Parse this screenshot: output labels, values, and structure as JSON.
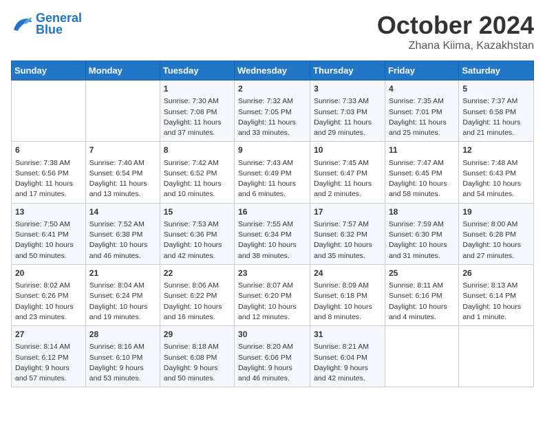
{
  "header": {
    "logo_line1": "General",
    "logo_line2": "Blue",
    "month": "October 2024",
    "location": "Zhana Kiima, Kazakhstan"
  },
  "days_of_week": [
    "Sunday",
    "Monday",
    "Tuesday",
    "Wednesday",
    "Thursday",
    "Friday",
    "Saturday"
  ],
  "weeks": [
    [
      {
        "day": "",
        "sunrise": "",
        "sunset": "",
        "daylight": ""
      },
      {
        "day": "",
        "sunrise": "",
        "sunset": "",
        "daylight": ""
      },
      {
        "day": "1",
        "sunrise": "Sunrise: 7:30 AM",
        "sunset": "Sunset: 7:08 PM",
        "daylight": "Daylight: 11 hours and 37 minutes."
      },
      {
        "day": "2",
        "sunrise": "Sunrise: 7:32 AM",
        "sunset": "Sunset: 7:05 PM",
        "daylight": "Daylight: 11 hours and 33 minutes."
      },
      {
        "day": "3",
        "sunrise": "Sunrise: 7:33 AM",
        "sunset": "Sunset: 7:03 PM",
        "daylight": "Daylight: 11 hours and 29 minutes."
      },
      {
        "day": "4",
        "sunrise": "Sunrise: 7:35 AM",
        "sunset": "Sunset: 7:01 PM",
        "daylight": "Daylight: 11 hours and 25 minutes."
      },
      {
        "day": "5",
        "sunrise": "Sunrise: 7:37 AM",
        "sunset": "Sunset: 6:58 PM",
        "daylight": "Daylight: 11 hours and 21 minutes."
      }
    ],
    [
      {
        "day": "6",
        "sunrise": "Sunrise: 7:38 AM",
        "sunset": "Sunset: 6:56 PM",
        "daylight": "Daylight: 11 hours and 17 minutes."
      },
      {
        "day": "7",
        "sunrise": "Sunrise: 7:40 AM",
        "sunset": "Sunset: 6:54 PM",
        "daylight": "Daylight: 11 hours and 13 minutes."
      },
      {
        "day": "8",
        "sunrise": "Sunrise: 7:42 AM",
        "sunset": "Sunset: 6:52 PM",
        "daylight": "Daylight: 11 hours and 10 minutes."
      },
      {
        "day": "9",
        "sunrise": "Sunrise: 7:43 AM",
        "sunset": "Sunset: 6:49 PM",
        "daylight": "Daylight: 11 hours and 6 minutes."
      },
      {
        "day": "10",
        "sunrise": "Sunrise: 7:45 AM",
        "sunset": "Sunset: 6:47 PM",
        "daylight": "Daylight: 11 hours and 2 minutes."
      },
      {
        "day": "11",
        "sunrise": "Sunrise: 7:47 AM",
        "sunset": "Sunset: 6:45 PM",
        "daylight": "Daylight: 10 hours and 58 minutes."
      },
      {
        "day": "12",
        "sunrise": "Sunrise: 7:48 AM",
        "sunset": "Sunset: 6:43 PM",
        "daylight": "Daylight: 10 hours and 54 minutes."
      }
    ],
    [
      {
        "day": "13",
        "sunrise": "Sunrise: 7:50 AM",
        "sunset": "Sunset: 6:41 PM",
        "daylight": "Daylight: 10 hours and 50 minutes."
      },
      {
        "day": "14",
        "sunrise": "Sunrise: 7:52 AM",
        "sunset": "Sunset: 6:38 PM",
        "daylight": "Daylight: 10 hours and 46 minutes."
      },
      {
        "day": "15",
        "sunrise": "Sunrise: 7:53 AM",
        "sunset": "Sunset: 6:36 PM",
        "daylight": "Daylight: 10 hours and 42 minutes."
      },
      {
        "day": "16",
        "sunrise": "Sunrise: 7:55 AM",
        "sunset": "Sunset: 6:34 PM",
        "daylight": "Daylight: 10 hours and 38 minutes."
      },
      {
        "day": "17",
        "sunrise": "Sunrise: 7:57 AM",
        "sunset": "Sunset: 6:32 PM",
        "daylight": "Daylight: 10 hours and 35 minutes."
      },
      {
        "day": "18",
        "sunrise": "Sunrise: 7:59 AM",
        "sunset": "Sunset: 6:30 PM",
        "daylight": "Daylight: 10 hours and 31 minutes."
      },
      {
        "day": "19",
        "sunrise": "Sunrise: 8:00 AM",
        "sunset": "Sunset: 6:28 PM",
        "daylight": "Daylight: 10 hours and 27 minutes."
      }
    ],
    [
      {
        "day": "20",
        "sunrise": "Sunrise: 8:02 AM",
        "sunset": "Sunset: 6:26 PM",
        "daylight": "Daylight: 10 hours and 23 minutes."
      },
      {
        "day": "21",
        "sunrise": "Sunrise: 8:04 AM",
        "sunset": "Sunset: 6:24 PM",
        "daylight": "Daylight: 10 hours and 19 minutes."
      },
      {
        "day": "22",
        "sunrise": "Sunrise: 8:06 AM",
        "sunset": "Sunset: 6:22 PM",
        "daylight": "Daylight: 10 hours and 16 minutes."
      },
      {
        "day": "23",
        "sunrise": "Sunrise: 8:07 AM",
        "sunset": "Sunset: 6:20 PM",
        "daylight": "Daylight: 10 hours and 12 minutes."
      },
      {
        "day": "24",
        "sunrise": "Sunrise: 8:09 AM",
        "sunset": "Sunset: 6:18 PM",
        "daylight": "Daylight: 10 hours and 8 minutes."
      },
      {
        "day": "25",
        "sunrise": "Sunrise: 8:11 AM",
        "sunset": "Sunset: 6:16 PM",
        "daylight": "Daylight: 10 hours and 4 minutes."
      },
      {
        "day": "26",
        "sunrise": "Sunrise: 8:13 AM",
        "sunset": "Sunset: 6:14 PM",
        "daylight": "Daylight: 10 hours and 1 minute."
      }
    ],
    [
      {
        "day": "27",
        "sunrise": "Sunrise: 8:14 AM",
        "sunset": "Sunset: 6:12 PM",
        "daylight": "Daylight: 9 hours and 57 minutes."
      },
      {
        "day": "28",
        "sunrise": "Sunrise: 8:16 AM",
        "sunset": "Sunset: 6:10 PM",
        "daylight": "Daylight: 9 hours and 53 minutes."
      },
      {
        "day": "29",
        "sunrise": "Sunrise: 8:18 AM",
        "sunset": "Sunset: 6:08 PM",
        "daylight": "Daylight: 9 hours and 50 minutes."
      },
      {
        "day": "30",
        "sunrise": "Sunrise: 8:20 AM",
        "sunset": "Sunset: 6:06 PM",
        "daylight": "Daylight: 9 hours and 46 minutes."
      },
      {
        "day": "31",
        "sunrise": "Sunrise: 8:21 AM",
        "sunset": "Sunset: 6:04 PM",
        "daylight": "Daylight: 9 hours and 42 minutes."
      },
      {
        "day": "",
        "sunrise": "",
        "sunset": "",
        "daylight": ""
      },
      {
        "day": "",
        "sunrise": "",
        "sunset": "",
        "daylight": ""
      }
    ]
  ]
}
